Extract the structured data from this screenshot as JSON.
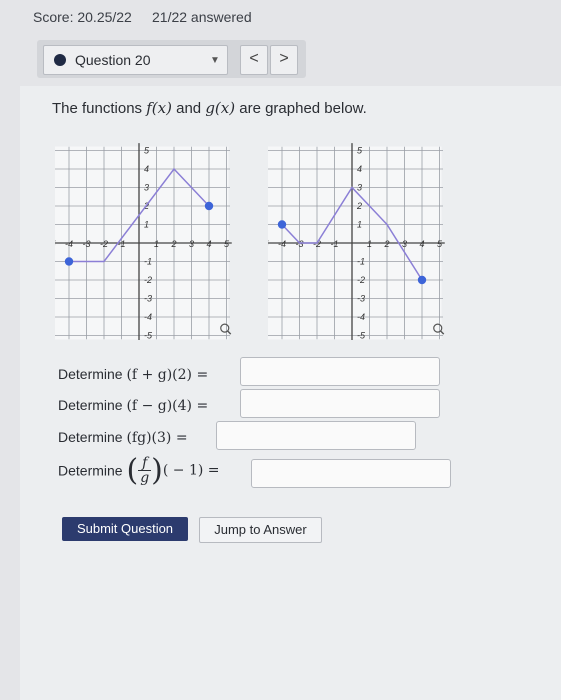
{
  "header": {
    "score": "Score: 20.25/22",
    "answered": "21/22 answered"
  },
  "question_nav": {
    "label": "Question 20",
    "prev": "<",
    "next": ">"
  },
  "prompt": {
    "before": "The functions ",
    "f": "f(x)",
    "mid": " and ",
    "g": "g(x)",
    "after": " are graphed below."
  },
  "graphs": {
    "ticks_x": [
      "-5",
      "-4",
      "-3",
      "-2",
      "-1",
      "1",
      "2",
      "3",
      "4",
      "5"
    ],
    "ticks_y": [
      "5",
      "4",
      "3",
      "2",
      "1",
      "-1",
      "-2",
      "-3",
      "-4",
      "-5"
    ],
    "f_points": [
      [
        -4,
        -1
      ],
      [
        -2,
        -1
      ],
      [
        2,
        4
      ],
      [
        4,
        2
      ]
    ],
    "g_points": [
      [
        -4,
        1
      ],
      [
        -3,
        0
      ],
      [
        -2,
        0
      ],
      [
        0,
        3
      ],
      [
        2,
        1
      ],
      [
        4,
        -2
      ]
    ],
    "line_color": "#8b7fd6",
    "dot_color": "#3d64d8",
    "grid_color": "#9a9ea6"
  },
  "questions": {
    "q1": {
      "prefix": "Determine ",
      "expr": "(f + g)(2) ="
    },
    "q2": {
      "prefix": "Determine ",
      "expr": "(f − g)(4) ="
    },
    "q3": {
      "prefix": "Determine ",
      "expr": "(fg)(3) ="
    },
    "q4": {
      "prefix": "Determine ",
      "num": "f",
      "den": "g",
      "tail": "( − 1) ="
    }
  },
  "buttons": {
    "submit": "Submit Question",
    "jump": "Jump to Answer"
  }
}
